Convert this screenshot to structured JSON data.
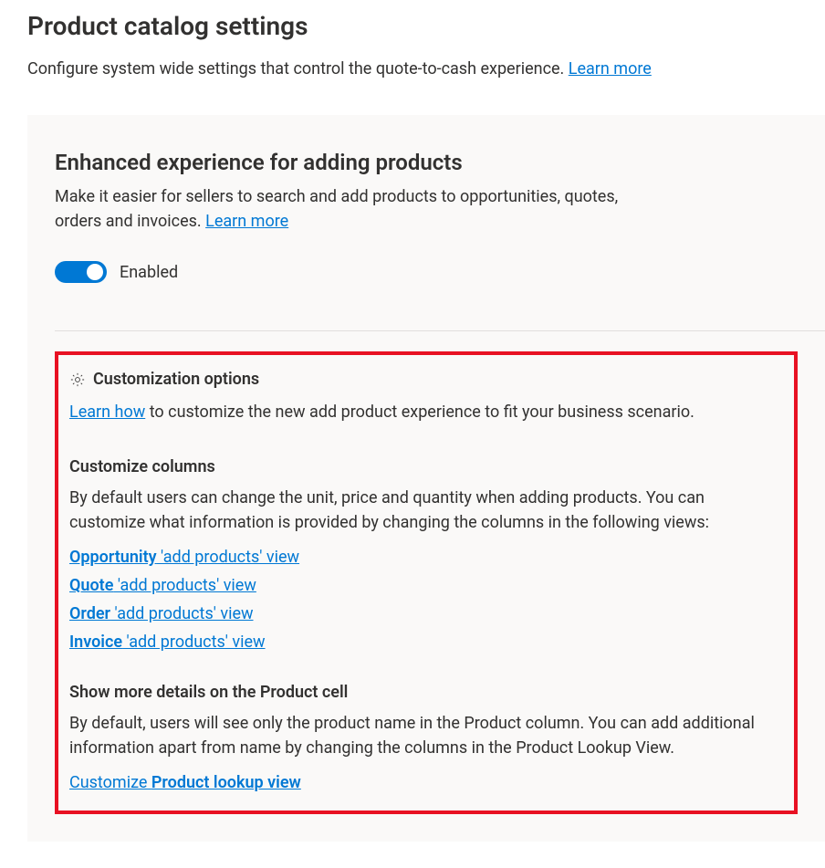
{
  "page": {
    "title": "Product catalog settings",
    "subtitle_text": "Configure system wide settings that control the quote-to-cash experience. ",
    "subtitle_link": "Learn more"
  },
  "enhanced": {
    "title": "Enhanced experience for adding products",
    "desc_text": "Make it easier for sellers to search and add products to opportunities, quotes, orders and invoices. ",
    "desc_link": "Learn more",
    "toggle_label": "Enabled",
    "toggle_on": true
  },
  "customization": {
    "title": "Customization options",
    "intro_link": "Learn how",
    "intro_text": " to customize the new add product experience to fit your business scenario.",
    "columns": {
      "heading": "Customize columns",
      "desc": "By default users can change the unit, price and quantity when adding products. You can customize what information is provided by changing the columns in the following views:",
      "views": [
        {
          "bold": "Opportunity",
          "rest": " 'add products' view"
        },
        {
          "bold": "Quote",
          "rest": " 'add products' view"
        },
        {
          "bold": "Order",
          "rest": " 'add products' view"
        },
        {
          "bold": "Invoice",
          "rest": " 'add products' view"
        }
      ]
    },
    "product_cell": {
      "heading": "Show more details on the Product cell",
      "desc": "By default, users will see only the product name in the Product column. You can add additional information apart from name by changing the columns in the Product Lookup View.",
      "link_prefix": "Customize ",
      "link_bold": "Product lookup view"
    }
  }
}
